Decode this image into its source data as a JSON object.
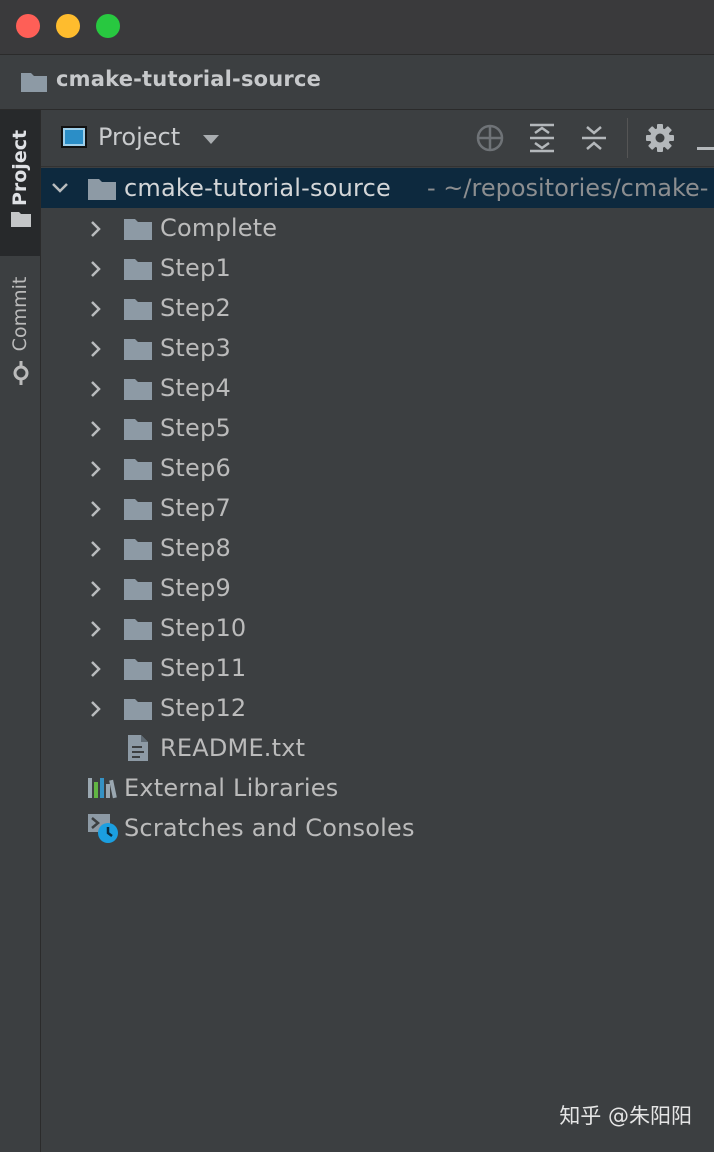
{
  "window": {
    "title": "cmake-tutorial-source"
  },
  "sidebar": {
    "tabs": [
      {
        "label": "Project",
        "icon": "folder-icon",
        "active": true
      },
      {
        "label": "Commit",
        "icon": "commit-icon",
        "active": false
      }
    ]
  },
  "toolbar": {
    "view_label": "Project",
    "icons": [
      "locate-icon",
      "expand-all-icon",
      "collapse-all-icon",
      "gear-icon",
      "minimize-icon"
    ]
  },
  "tree": {
    "root": {
      "label": "cmake-tutorial-source",
      "path": "- ~/repositories/cmake-"
    },
    "children": [
      {
        "label": "Complete"
      },
      {
        "label": "Step1"
      },
      {
        "label": "Step2"
      },
      {
        "label": "Step3"
      },
      {
        "label": "Step4"
      },
      {
        "label": "Step5"
      },
      {
        "label": "Step6"
      },
      {
        "label": "Step7"
      },
      {
        "label": "Step8"
      },
      {
        "label": "Step9"
      },
      {
        "label": "Step10"
      },
      {
        "label": "Step11"
      },
      {
        "label": "Step12"
      }
    ],
    "file": {
      "label": "README.txt"
    },
    "external_libraries": {
      "label": "External Libraries"
    },
    "scratches": {
      "label": "Scratches and Consoles"
    }
  },
  "watermark": "知乎 @朱阳阳",
  "colors": {
    "panel_bg": "#3c3f41",
    "selection_bg": "#0d293e",
    "folder": "#8d9aa5",
    "accent_blue": "#3592c4"
  }
}
